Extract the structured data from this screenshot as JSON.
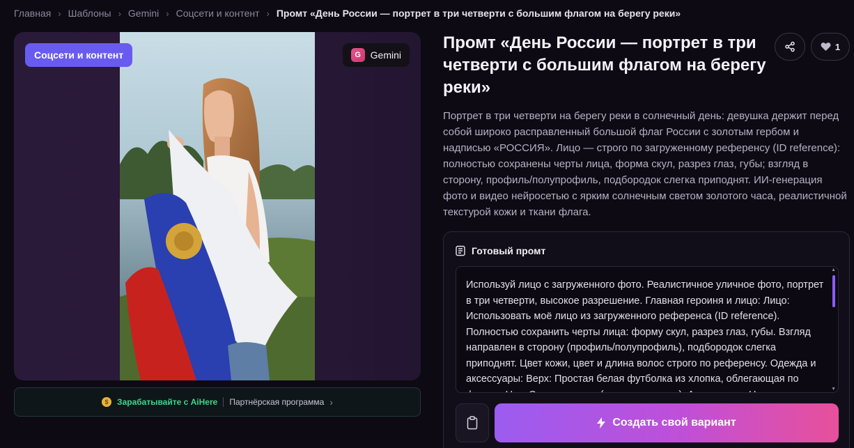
{
  "breadcrumb": [
    {
      "label": "Главная"
    },
    {
      "label": "Шаблоны"
    },
    {
      "label": "Gemini"
    },
    {
      "label": "Соцсети и контент"
    },
    {
      "label": "Промт «День России — портрет в три четверти с большим флагом на берегу реки»"
    }
  ],
  "media": {
    "category_badge": "Соцсети и контент",
    "model_badge": "Gemini",
    "model_icon_letter": "G"
  },
  "partner": {
    "earn_label": "Зарабатывайте с AiHere",
    "program_label": "Партнёрская программа"
  },
  "title": "Промт «День России — портрет в три четверти с большим флагом на берегу реки»",
  "like_count": "1",
  "description": "Портрет в три четверти на берегу реки в солнечный день: девушка держит перед собой широко расправленный большой флаг России с золотым гербом и надписью «РОССИЯ». Лицо — строго по загруженному референсу (ID reference): полностью сохранены черты лица, форма скул, разрез глаз, губы; взгляд в сторону, профиль/полупрофиль, подбородок слегка приподнят. ИИ-генерация фото и видео нейросетью с ярким солнечным светом золотого часа, реалистичной текстурой кожи и ткани флага.",
  "prompt": {
    "header": "Готовый промт",
    "text": "Используй лицо с загруженного фото. Реалистичное уличное фото, портрет в три четверти, высокое разрешение. Главная героиня и лицо: Лицо: Использовать моё лицо из загруженного референса (ID reference). Полностью сохранить черты лица: форму скул, разрез глаз, губы. Взгляд направлен в сторону (профиль/полупрофиль), подбородок слегка приподнят. Цвет кожи, цвет и длина волос строго по референсу. Одежда и аксессуары: Верх: Простая белая футболка из хлопка, облегающая по фигуре. Низ: Синие джинсы (видны частично). Аксессуары: На левом",
    "create_button": "Создать свой вариант"
  },
  "colors": {
    "accent_purple": "#6a5bf0",
    "earn_green": "#3dd68c",
    "button_gradient_start": "#9b5cf0",
    "button_gradient_end": "#e8509a"
  }
}
